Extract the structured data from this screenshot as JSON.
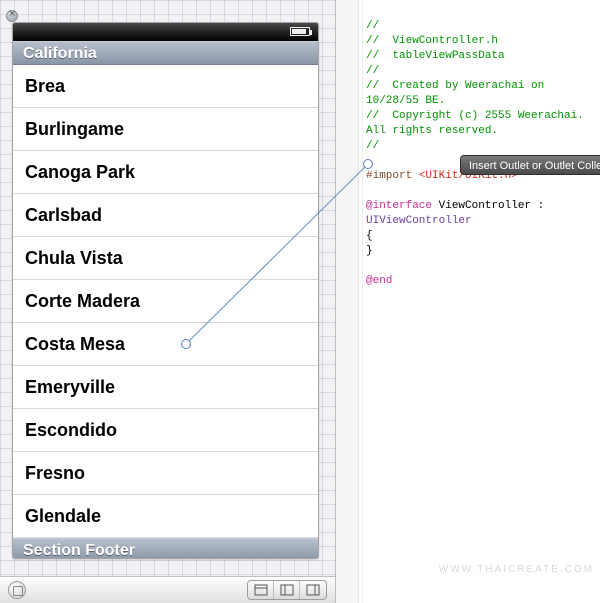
{
  "table": {
    "header": "California",
    "footer": "Section Footer",
    "rows": [
      "Brea",
      "Burlingame",
      "Canoga Park",
      "Carlsbad",
      "Chula Vista",
      "Corte Madera",
      "Costa Mesa",
      "Emeryville",
      "Escondido",
      "Fresno",
      "Glendale"
    ]
  },
  "code": {
    "c1": "//",
    "c2": "//  ViewController.h",
    "c3": "//  tableViewPassData",
    "c4": "//",
    "c5": "//  Created by Weerachai on 10/28/55 BE.",
    "c6": "//  Copyright (c) 2555 Weerachai. All rights reserved.",
    "c7": "//",
    "import_pre": "#import ",
    "import_hdr": "<UIKit/UIKit.h>",
    "iface_kw": "@interface",
    "iface_rest": " ViewController : ",
    "iface_type": "UIViewController",
    "brace_open": "{",
    "brace_close": "}",
    "end_kw": "@end"
  },
  "hint": "Insert Outlet or Outlet Colle",
  "watermark": "WWW.THAICREATE.COM"
}
